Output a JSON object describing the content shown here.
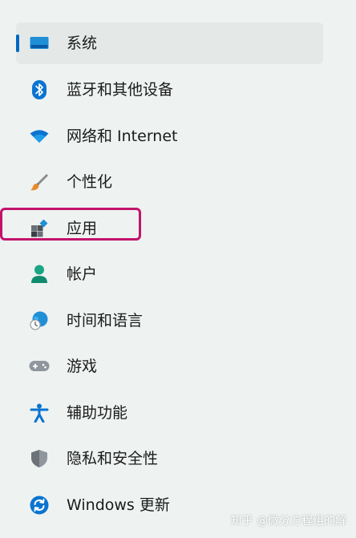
{
  "nav": {
    "items": [
      {
        "label": "系统",
        "icon": "system-display-icon",
        "selected": true
      },
      {
        "label": "蓝牙和其他设备",
        "icon": "bluetooth-icon"
      },
      {
        "label": "网络和 Internet",
        "icon": "wifi-icon"
      },
      {
        "label": "个性化",
        "icon": "paintbrush-icon"
      },
      {
        "label": "应用",
        "icon": "apps-icon",
        "highlighted": true
      },
      {
        "label": "帐户",
        "icon": "account-person-icon"
      },
      {
        "label": "时间和语言",
        "icon": "globe-clock-icon"
      },
      {
        "label": "游戏",
        "icon": "gamepad-icon"
      },
      {
        "label": "辅助功能",
        "icon": "accessibility-icon"
      },
      {
        "label": "隐私和安全性",
        "icon": "shield-icon"
      },
      {
        "label": "Windows 更新",
        "icon": "windows-update-icon"
      }
    ]
  },
  "watermark": "知乎 @微分方程组的解",
  "colors": {
    "accent": "#0067c0",
    "highlight_border": "#c2136b",
    "selected_bg": "#e4e9e8",
    "page_bg": "#eef2f1"
  }
}
